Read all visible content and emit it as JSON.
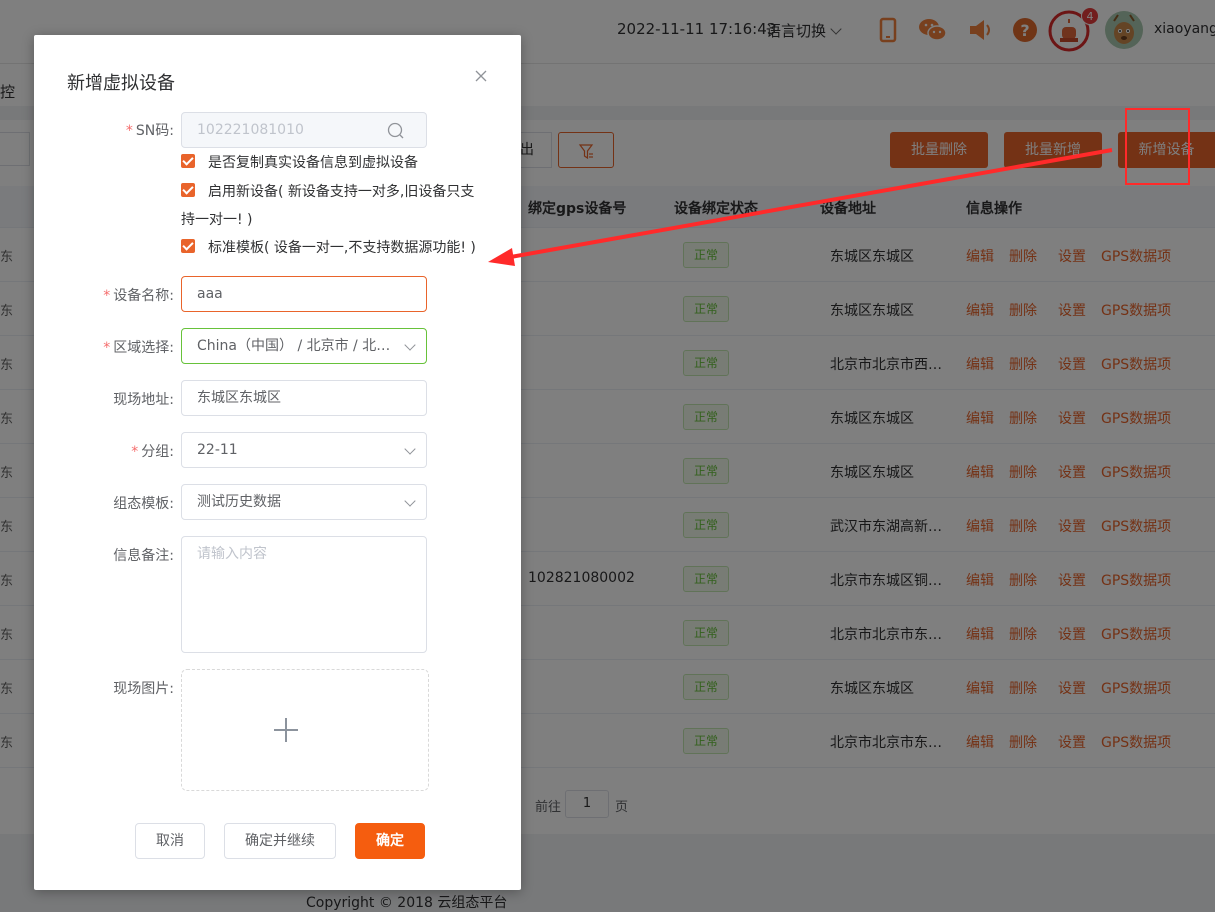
{
  "header": {
    "datetime": "2022-11-11 17:16:43",
    "lang_switch": "语言切换",
    "username": "xiaoyang",
    "notification_count": "4",
    "icons": [
      "phone-icon",
      "wechat-icon",
      "speaker-icon",
      "help-icon",
      "alarm-icon"
    ]
  },
  "subnav": {
    "label": "控"
  },
  "toolbar": {
    "export_label": "出",
    "batch_delete": "批量删除",
    "batch_add": "批量新增",
    "add_device": "新增设备"
  },
  "table": {
    "headers": [
      "绑定gps设备号",
      "设备绑定状态",
      "设备地址",
      "信息操作"
    ],
    "rows": [
      {
        "left": "东",
        "gps": "",
        "status": "正常",
        "addr": "东城区东城区"
      },
      {
        "left": "东",
        "gps": "",
        "status": "正常",
        "addr": "东城区东城区"
      },
      {
        "left": "东",
        "gps": "",
        "status": "正常",
        "addr": "北京市北京市西…"
      },
      {
        "left": "东",
        "gps": "",
        "status": "正常",
        "addr": "东城区东城区"
      },
      {
        "left": "东",
        "gps": "",
        "status": "正常",
        "addr": "东城区东城区"
      },
      {
        "left": "东",
        "gps": "",
        "status": "正常",
        "addr": "武汉市东湖高新…"
      },
      {
        "left": "东",
        "gps": "102821080002",
        "status": "正常",
        "addr": "北京市东城区铜…"
      },
      {
        "left": "东",
        "gps": "",
        "status": "正常",
        "addr": "北京市北京市东…"
      },
      {
        "left": "东",
        "gps": "",
        "status": "正常",
        "addr": "东城区东城区"
      },
      {
        "left": "东",
        "gps": "",
        "status": "正常",
        "addr": "北京市北京市东…"
      }
    ],
    "ops": [
      "编辑",
      "删除",
      "设置",
      "GPS数据项"
    ]
  },
  "pager": {
    "goto": "前往",
    "page": "1",
    "suffix": "页"
  },
  "footer": {
    "copyright": "Copyright © 2018 云组态平台"
  },
  "dialog": {
    "title": "新增虚拟设备",
    "sn_label": "SN码:",
    "sn_value": "102221081010",
    "checkbox1": "是否复制真实设备信息到虚拟设备",
    "checkbox2_line1": "启用新设备( 新设备支持一对多,旧设备只支",
    "checkbox2_line2": "持一对一! )",
    "checkbox3": "标准模板( 设备一对一,不支持数据源功能! )",
    "name_label": "设备名称:",
    "name_value": "aaa",
    "region_label": "区域选择:",
    "region_value": "China（中国） / 北京市 / 北京…",
    "address_label": "现场地址:",
    "address_value": "东城区东城区",
    "group_label": "分组:",
    "group_value": "22-11",
    "template_label": "组态模板:",
    "template_value": "测试历史数据",
    "remark_label": "信息备注:",
    "remark_placeholder": "请输入内容",
    "image_label": "现场图片:",
    "cancel": "取消",
    "confirm_continue": "确定并继续",
    "confirm": "确定"
  },
  "colors": {
    "accent": "#e9642b",
    "primary_btn": "#f55d0f",
    "success": "#67c23a",
    "annotation": "#ff2a2a"
  }
}
